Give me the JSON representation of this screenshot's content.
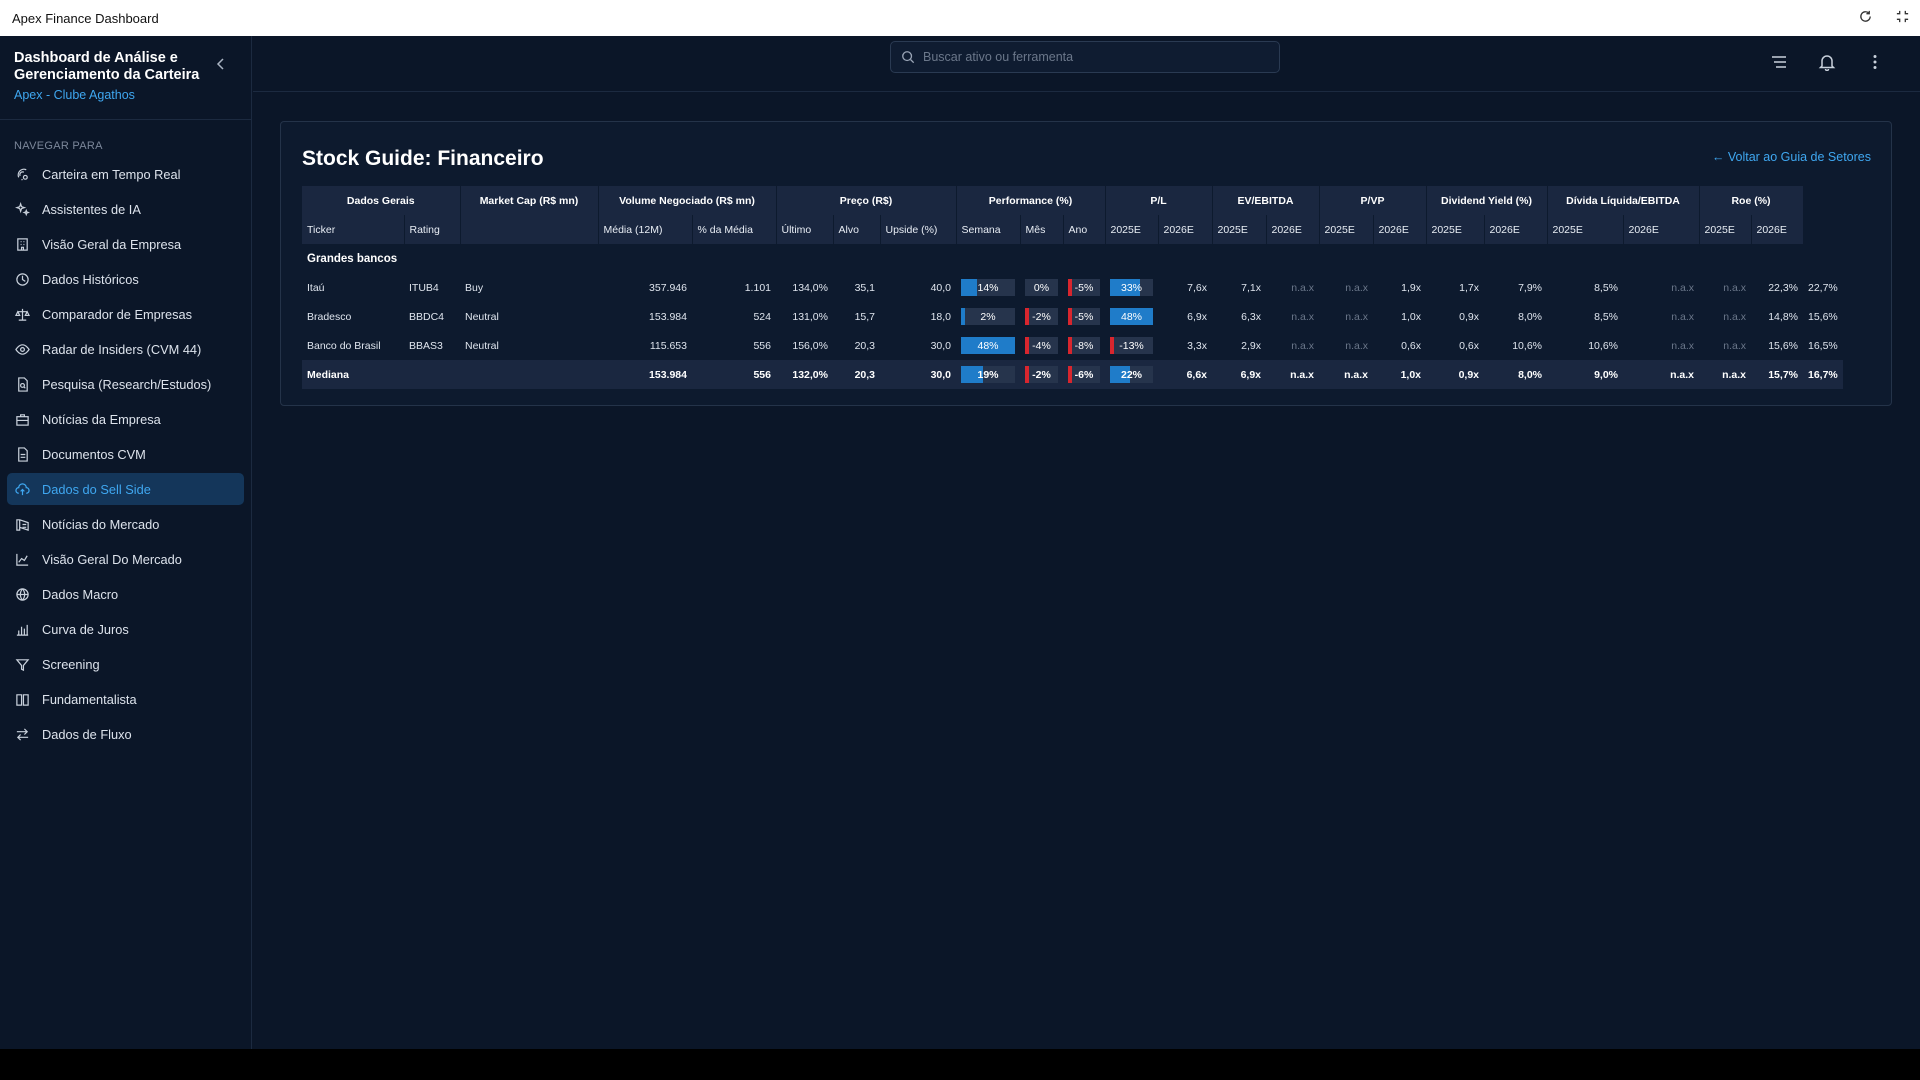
{
  "window": {
    "title": "Apex Finance Dashboard"
  },
  "sidebar": {
    "title": "Dashboard de Análise e Gerenciamento da Carteira",
    "subtitle": "Apex - Clube Agathos",
    "nav_label": "NAVEGAR PARA",
    "items": [
      {
        "label": "Carteira em Tempo Real",
        "icon": "realtime-icon"
      },
      {
        "label": "Assistentes de IA",
        "icon": "sparkles-icon"
      },
      {
        "label": "Visão Geral da Empresa",
        "icon": "building-icon"
      },
      {
        "label": "Dados Históricos",
        "icon": "history-icon"
      },
      {
        "label": "Comparador de Empresas",
        "icon": "scale-icon"
      },
      {
        "label": "Radar de Insiders (CVM 44)",
        "icon": "eye-icon"
      },
      {
        "label": "Pesquisa (Research/Estudos)",
        "icon": "document-search-icon"
      },
      {
        "label": "Notícias da Empresa",
        "icon": "briefcase-icon"
      },
      {
        "label": "Documentos CVM",
        "icon": "file-icon"
      },
      {
        "label": "Dados do Sell Side",
        "icon": "cloud-upload-icon"
      },
      {
        "label": "Notícias do Mercado",
        "icon": "news-icon"
      },
      {
        "label": "Visão Geral Do Mercado",
        "icon": "chart-area-icon"
      },
      {
        "label": "Dados Macro",
        "icon": "globe-icon"
      },
      {
        "label": "Curva de Juros",
        "icon": "bar-chart-icon"
      },
      {
        "label": "Screening",
        "icon": "filter-icon"
      },
      {
        "label": "Fundamentalista",
        "icon": "book-icon"
      },
      {
        "label": "Dados de Fluxo",
        "icon": "arrows-icon"
      }
    ],
    "active_index": 9
  },
  "search": {
    "placeholder": "Buscar ativo ou ferramenta"
  },
  "page": {
    "title": "Stock Guide: Financeiro",
    "back_link": "← Voltar ao Guia de Setores"
  },
  "table": {
    "group_headers": [
      "Dados Gerais",
      "Market Cap (R$ mn)",
      "Volume Negociado (R$ mn)",
      "Preço (R$)",
      "Performance (%)",
      "P/L",
      "EV/EBITDA",
      "P/VP",
      "Dividend Yield (%)",
      "Dívida Líquida/EBITDA",
      "Roe (%)"
    ],
    "sub_headers": [
      "Ticker",
      "Rating",
      "",
      "Média (12M)",
      "% da Média",
      "Último",
      "Alvo",
      "Upside (%)",
      "Semana",
      "Mês",
      "Ano",
      "2025E",
      "2026E",
      "2025E",
      "2026E",
      "2025E",
      "2026E",
      "2025E",
      "2026E",
      "2025E",
      "2026E",
      "2025E",
      "2026E"
    ],
    "group_label": "Grandes bancos",
    "rows": [
      {
        "name": "Itaú",
        "ticker": "ITUB4",
        "rating": "Buy",
        "mcap": "357.946",
        "vol_avg": "1.101",
        "vol_pct": "134,0%",
        "last": "35,1",
        "target": "40,0",
        "upside": {
          "text": "14%",
          "value": 14
        },
        "week": {
          "text": "0%",
          "value": 0
        },
        "month": {
          "text": "-5%",
          "value": -5
        },
        "year": {
          "text": "33%",
          "value": 33
        },
        "pl25": "7,6x",
        "pl26": "7,1x",
        "ev25": "n.a.x",
        "ev26": "n.a.x",
        "pvp25": "1,9x",
        "pvp26": "1,7x",
        "dy25": "7,9%",
        "dy26": "8,5%",
        "nd25": "n.a.x",
        "nd26": "n.a.x",
        "roe25": "22,3%",
        "roe26": "22,7%"
      },
      {
        "name": "Bradesco",
        "ticker": "BBDC4",
        "rating": "Neutral",
        "mcap": "153.984",
        "vol_avg": "524",
        "vol_pct": "131,0%",
        "last": "15,7",
        "target": "18,0",
        "upside": {
          "text": "2%",
          "value": 2
        },
        "week": {
          "text": "-2%",
          "value": -2
        },
        "month": {
          "text": "-5%",
          "value": -5
        },
        "year": {
          "text": "48%",
          "value": 48
        },
        "pl25": "6,9x",
        "pl26": "6,3x",
        "ev25": "n.a.x",
        "ev26": "n.a.x",
        "pvp25": "1,0x",
        "pvp26": "0,9x",
        "dy25": "8,0%",
        "dy26": "8,5%",
        "nd25": "n.a.x",
        "nd26": "n.a.x",
        "roe25": "14,8%",
        "roe26": "15,6%"
      },
      {
        "name": "Banco do Brasil",
        "ticker": "BBAS3",
        "rating": "Neutral",
        "mcap": "115.653",
        "vol_avg": "556",
        "vol_pct": "156,0%",
        "last": "20,3",
        "target": "30,0",
        "upside": {
          "text": "48%",
          "value": 48
        },
        "week": {
          "text": "-4%",
          "value": -4
        },
        "month": {
          "text": "-8%",
          "value": -8
        },
        "year": {
          "text": "-13%",
          "value": -13
        },
        "pl25": "3,3x",
        "pl26": "2,9x",
        "ev25": "n.a.x",
        "ev26": "n.a.x",
        "pvp25": "0,6x",
        "pvp26": "0,6x",
        "dy25": "10,6%",
        "dy26": "10,6%",
        "nd25": "n.a.x",
        "nd26": "n.a.x",
        "roe25": "15,6%",
        "roe26": "16,5%"
      }
    ],
    "median": {
      "name": "Mediana",
      "ticker": "",
      "rating": "",
      "mcap": "153.984",
      "vol_avg": "556",
      "vol_pct": "132,0%",
      "last": "20,3",
      "target": "30,0",
      "upside": {
        "text": "19%",
        "value": 19
      },
      "week": {
        "text": "-2%",
        "value": -2
      },
      "month": {
        "text": "-6%",
        "value": -6
      },
      "year": {
        "text": "22%",
        "value": 22
      },
      "pl25": "6,6x",
      "pl26": "6,9x",
      "ev25": "n.a.x",
      "ev26": "n.a.x",
      "pvp25": "1,0x",
      "pvp26": "0,9x",
      "dy25": "8,0%",
      "dy26": "9,0%",
      "nd25": "n.a.x",
      "nd26": "n.a.x",
      "roe25": "15,7%",
      "roe26": "16,7%"
    }
  },
  "colors": {
    "positive": "#1f7cc9",
    "negative": "#d8262e",
    "accent": "#3fa7f0"
  }
}
